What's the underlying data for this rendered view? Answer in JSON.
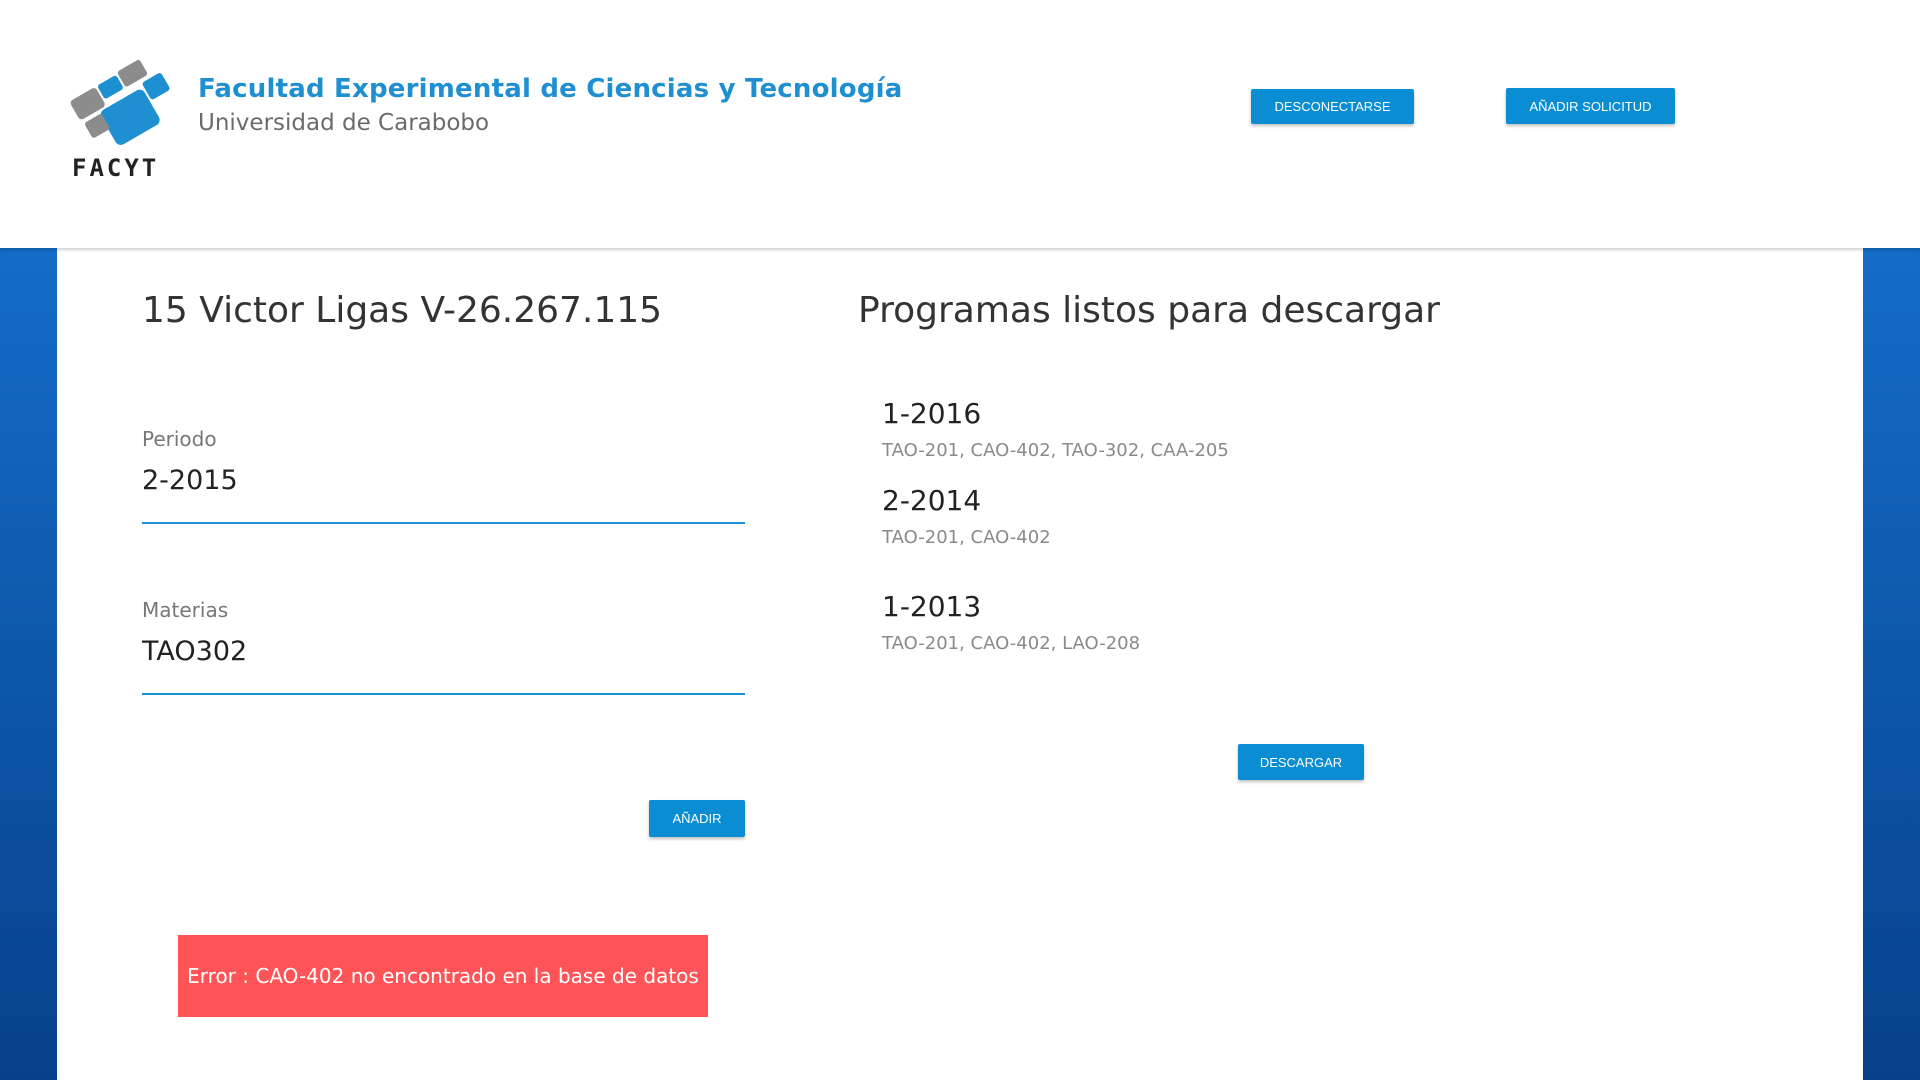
{
  "header": {
    "brand_title": "Facultad Experimental de Ciencias y Tecnología",
    "brand_subtitle": "Universidad de Carabobo",
    "logo_word": "FACYT",
    "logout_label": "DESCONECTARSE",
    "add_request_label": "AÑADIR SOLICITUD"
  },
  "student": {
    "title": "15 Victor Ligas V-26.267.115"
  },
  "form": {
    "periodo_label": "Periodo",
    "periodo_value": "2-2015",
    "materias_label": "Materias",
    "materias_value": "TAO302",
    "add_label": "AÑADIR"
  },
  "error": {
    "message": "Error : CAO-402 no encontrado en la base de datos"
  },
  "ready": {
    "title": "Programas listos para descargar",
    "programs": [
      {
        "period": "1-2016",
        "subjects": "TAO-201, CAO-402, TAO-302, CAA-205"
      },
      {
        "period": "2-2014",
        "subjects": "TAO-201, CAO-402"
      },
      {
        "period": "1-2013",
        "subjects": "TAO-201, CAO-402, LAO-208"
      }
    ],
    "download_label": "DESCARGAR"
  },
  "colors": {
    "primary": "#0a8dd2",
    "brand_blue": "#1e8fd0",
    "error": "#ff5457",
    "background_blue": "#1a78d8"
  },
  "icons": {
    "logo": "facyt-logo-icon"
  }
}
